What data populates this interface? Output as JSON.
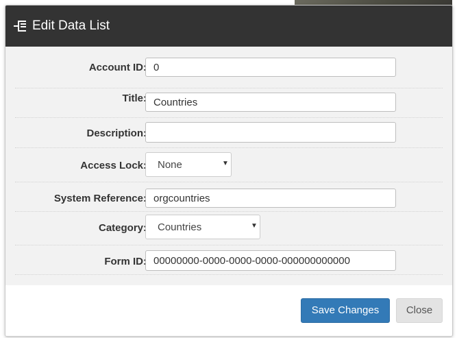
{
  "dialog": {
    "title": "Edit Data List",
    "icon": "list-tree-icon"
  },
  "form": {
    "account_id": {
      "label": "Account ID:",
      "value": "0"
    },
    "title": {
      "label": "Title:",
      "value": "Countries"
    },
    "description": {
      "label": "Description:",
      "value": ""
    },
    "access_lock": {
      "label": "Access Lock:",
      "selected": "None"
    },
    "system_reference": {
      "label": "System Reference:",
      "value": "orgcountries"
    },
    "category": {
      "label": "Category:",
      "selected": "Countries"
    },
    "form_id": {
      "label": "Form ID:",
      "value": "00000000-0000-0000-0000-000000000000"
    }
  },
  "footer": {
    "save_label": "Save Changes",
    "close_label": "Close"
  },
  "colors": {
    "header_bg": "#333333",
    "body_bg": "#f2f2f2",
    "primary": "#337ab7",
    "default_button": "#e3e3e3"
  }
}
